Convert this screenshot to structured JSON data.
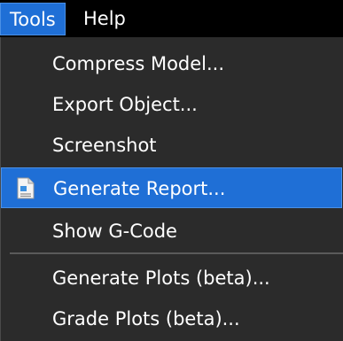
{
  "menubar": {
    "items": [
      {
        "label": "Tools"
      },
      {
        "label": "Help"
      }
    ]
  },
  "tools_menu": {
    "items": [
      {
        "label": "Compress Model..."
      },
      {
        "label": "Export Object..."
      },
      {
        "label": "Screenshot"
      },
      {
        "label": "Generate Report...",
        "icon": "document-icon"
      },
      {
        "label": "Show G-Code"
      },
      {
        "label": "Generate Plots (beta)..."
      },
      {
        "label": "Grade Plots (beta)..."
      }
    ]
  },
  "colors": {
    "highlight": "#1f6fd6",
    "menu_bg": "#2b2b2b",
    "menubar_bg": "#000000"
  }
}
